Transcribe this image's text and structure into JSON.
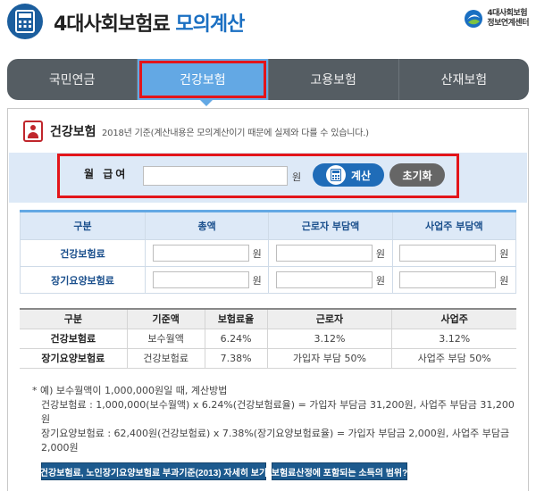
{
  "header": {
    "title_main": "4대사회보험료",
    "title_sub": "모의계산",
    "logo_line1": "4대사회보험",
    "logo_line2": "정보연계센터"
  },
  "tabs": [
    {
      "label": "국민연금",
      "active": false
    },
    {
      "label": "건강보험",
      "active": true
    },
    {
      "label": "고용보험",
      "active": false
    },
    {
      "label": "산재보험",
      "active": false
    }
  ],
  "section": {
    "title": "건강보험",
    "note": "2018년 기준(계산내용은 모의계산이기 때문에 실제와 다를 수 있습니다.)"
  },
  "salary": {
    "label": "월 급여",
    "value": "",
    "unit": "원",
    "calc_label": "계산",
    "reset_label": "초기화"
  },
  "result_table": {
    "headers": [
      "구분",
      "총액",
      "근로자 부담액",
      "사업주 부담액"
    ],
    "unit": "원",
    "rows": [
      {
        "label": "건강보험료"
      },
      {
        "label": "장기요양보험료"
      }
    ]
  },
  "rate_table": {
    "headers": [
      "구분",
      "기준액",
      "보험료율",
      "근로자",
      "사업주"
    ],
    "rows": [
      [
        "건강보험료",
        "보수월액",
        "6.24%",
        "3.12%",
        "3.12%"
      ],
      [
        "장기요양보험료",
        "건강보험료",
        "7.38%",
        "가입자 부담 50%",
        "사업주 부담 50%"
      ]
    ]
  },
  "notes": {
    "line1": "* 예) 보수월액이 1,000,000원일 때, 계산방법",
    "line2": "건강보험료 : 1,000,000(보수월액) x 6.24%(건강보험료율) = 가입자 부담금 31,200원, 사업주 부담금 31,200원",
    "line3": "장기요양보험료 : 62,400원(건강보험료) x 7.38%(장기요양보험료율) = 가입자 부담금 2,000원, 사업주 부담금 2,000원"
  },
  "buttons": {
    "criteria": "건강보험료, 노인장기요양보험료 부과기준(2013) 자세히 보기",
    "income_scope": "보험료산정에 포함되는 소득의 범위?"
  },
  "colors": {
    "brand_blue": "#1f6cb8",
    "tab_active": "#63a8e4",
    "highlight_red": "#e3151a"
  }
}
